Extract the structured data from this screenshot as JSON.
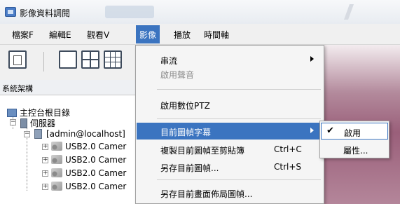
{
  "window": {
    "title": "影像資料調閱"
  },
  "menubar": {
    "items": [
      "檔案F",
      "編輯E",
      "觀看V",
      "影像",
      "播放",
      "時間軸"
    ],
    "active": "影像"
  },
  "panel": {
    "header": "系統架構",
    "tree": {
      "root": "主控台根目錄",
      "server_group": "伺服器",
      "server": "[admin@localhost]",
      "cameras": [
        "USB2.0 Camer",
        "USB2.0 Camer",
        "USB2.0 Camer",
        "USB2.0 Camer"
      ]
    }
  },
  "image_menu": {
    "items": [
      {
        "label": "串流",
        "shortcut": "",
        "submenu": true,
        "disabled": false,
        "highlighted": false
      },
      {
        "label": "啟用聲音",
        "shortcut": "",
        "submenu": false,
        "disabled": true,
        "highlighted": false
      },
      {
        "label": "啟用數位PTZ",
        "shortcut": "",
        "submenu": false,
        "disabled": false,
        "highlighted": false
      },
      {
        "label": "目前圖幀字幕",
        "shortcut": "",
        "submenu": true,
        "disabled": false,
        "highlighted": true
      },
      {
        "label": "複製目前圖幀至剪貼簿",
        "shortcut": "Ctrl+C",
        "submenu": false,
        "disabled": false,
        "highlighted": false
      },
      {
        "label": "另存目前圖幀...",
        "shortcut": "Ctrl+S",
        "submenu": false,
        "disabled": false,
        "highlighted": false
      },
      {
        "label": "另存目前畫面佈局圖幀...",
        "shortcut": "",
        "submenu": false,
        "disabled": false,
        "highlighted": false
      }
    ]
  },
  "caption_submenu": {
    "items": [
      {
        "label": "啟用",
        "checked": true
      },
      {
        "label": "屬性...",
        "checked": false
      }
    ]
  },
  "colors": {
    "highlight": "#3b74c0",
    "menu_bg": "#f5f5f5"
  }
}
